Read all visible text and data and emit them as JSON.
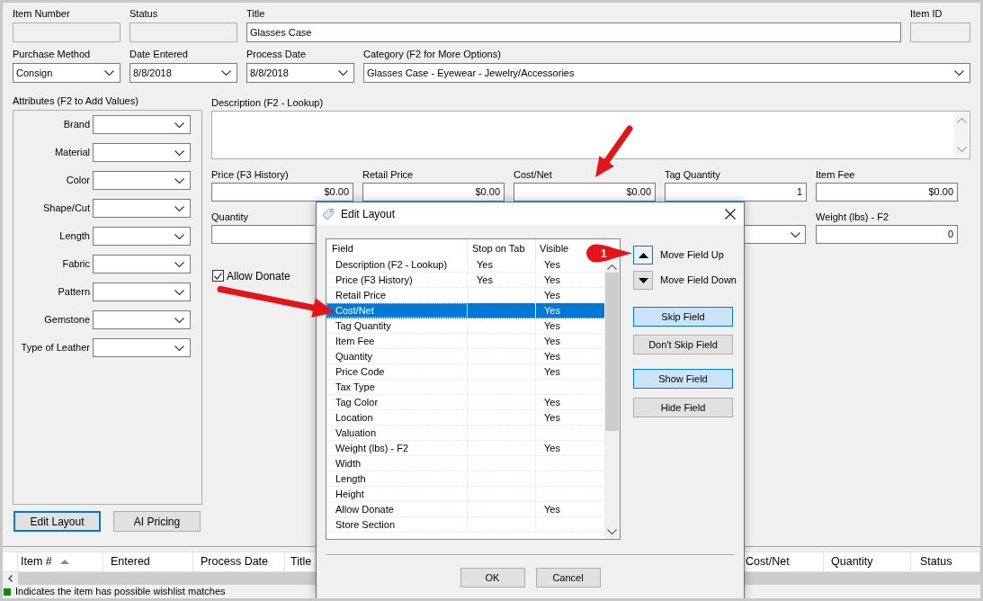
{
  "form": {
    "top_fields": [
      {
        "label": "Item Number",
        "disabled": true
      },
      {
        "label": "Status",
        "disabled": true
      },
      {
        "label": "Title",
        "disabled": false,
        "value": "Glasses Case"
      },
      {
        "label": "Item ID",
        "disabled": true
      }
    ],
    "dropdowns": [
      {
        "label": "Purchase Method",
        "value": "Consign"
      },
      {
        "label": "Date Entered",
        "value": "8/8/2018"
      },
      {
        "label": "Process Date",
        "value": "8/8/2018"
      },
      {
        "label": "Category (F2 for More Options)",
        "value": "Glasses Case - Eyewear - Jewelry/Accessories"
      }
    ],
    "attributes": {
      "title": "Attributes (F2 to Add Values)",
      "items": [
        "Brand",
        "Material",
        "Color",
        "Shape/Cut",
        "Length",
        "Fabric",
        "Pattern",
        "Gemstone",
        "Type of Leather"
      ]
    },
    "buttons": [
      {
        "label": "Edit Layout",
        "focused": true
      },
      {
        "label": "AI Pricing",
        "focused": false
      }
    ],
    "description": {
      "label": "Description (F2 - Lookup)"
    },
    "price_fields": [
      {
        "label": "Price (F3 History)",
        "value": "$0.00"
      },
      {
        "label": "Retail Price",
        "value": "$0.00"
      },
      {
        "label": "Cost/Net",
        "value": "$0.00"
      },
      {
        "label": "Tag Quantity",
        "value": "1"
      },
      {
        "label": "Item Fee",
        "value": "$0.00"
      }
    ],
    "quantity": {
      "label": "Quantity"
    },
    "weight": {
      "label": "Weight (lbs) - F2",
      "value": "0"
    },
    "allow_donate": {
      "label": "Allow Donate",
      "checked": true
    }
  },
  "grid": {
    "columns": [
      {
        "label": "Item #",
        "sorted": true
      },
      {
        "label": "Entered",
        "sorted": false
      },
      {
        "label": "Process Date",
        "sorted": false
      },
      {
        "label": "Title",
        "sorted": false
      },
      {
        "label": "Cost/Net",
        "sorted": false
      },
      {
        "label": "Quantity",
        "sorted": false
      },
      {
        "label": "Status",
        "sorted": false
      }
    ],
    "legend": "Indicates the item has possible wishlist matches"
  },
  "dialog": {
    "title": "Edit Layout",
    "columns": [
      "Field",
      "Stop on Tab",
      "Visible"
    ],
    "rows": [
      {
        "field": "Description (F2 - Lookup)",
        "stop_on_tab": "Yes",
        "visible": "Yes",
        "selected": false
      },
      {
        "field": "Price (F3 History)",
        "stop_on_tab": "Yes",
        "visible": "Yes",
        "selected": false
      },
      {
        "field": "Retail Price",
        "visible": "Yes",
        "selected": false
      },
      {
        "field": "Cost/Net",
        "visible": "Yes",
        "selected": true
      },
      {
        "field": "Tag Quantity",
        "visible": "Yes",
        "selected": false
      },
      {
        "field": "Item Fee",
        "visible": "Yes",
        "selected": false
      },
      {
        "field": "Quantity",
        "visible": "Yes",
        "selected": false
      },
      {
        "field": "Price Code",
        "visible": "Yes",
        "selected": false
      },
      {
        "field": "Tax Type",
        "selected": false
      },
      {
        "field": "Tag Color",
        "visible": "Yes",
        "selected": false
      },
      {
        "field": "Location",
        "visible": "Yes",
        "selected": false
      },
      {
        "field": "Valuation",
        "selected": false
      },
      {
        "field": "Weight (lbs) - F2",
        "visible": "Yes",
        "selected": false
      },
      {
        "field": "Width",
        "selected": false
      },
      {
        "field": "Length",
        "selected": false
      },
      {
        "field": "Height",
        "selected": false
      },
      {
        "field": "Allow Donate",
        "visible": "Yes",
        "selected": false
      },
      {
        "field": "Store Section",
        "selected": false
      }
    ],
    "move_buttons": [
      {
        "label": "Move Field Up",
        "kind": "up",
        "highlighted": true
      },
      {
        "label": "Move Field Down",
        "kind": "down",
        "highlighted": false
      }
    ],
    "action_buttons": [
      {
        "label": "Skip Field",
        "highlighted": true
      },
      {
        "label": "Don't Skip Field",
        "highlighted": false
      },
      {
        "label": "Show Field",
        "highlighted": true
      },
      {
        "label": "Hide Field",
        "highlighted": false
      }
    ],
    "footer_buttons": [
      "OK",
      "Cancel"
    ]
  },
  "annotation": {
    "callout": "1"
  }
}
